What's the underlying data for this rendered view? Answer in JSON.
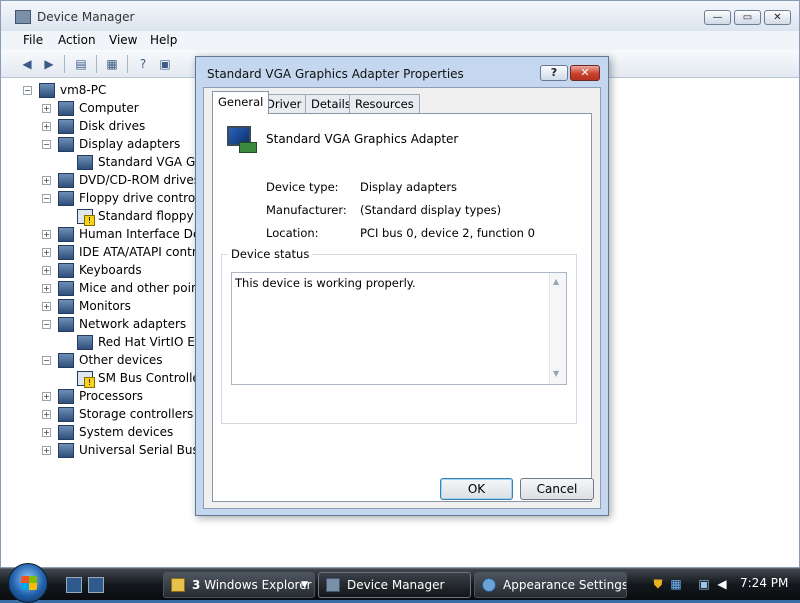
{
  "window": {
    "title": "Device Manager",
    "controls": {
      "minimize": "—",
      "maximize": "▭",
      "close": "✕"
    }
  },
  "menu": [
    "File",
    "Action",
    "View",
    "Help"
  ],
  "toolbar_icons": [
    "back-icon",
    "forward-icon",
    "properties-icon",
    "scan-icon",
    "help-icon",
    "view-icon"
  ],
  "tree": {
    "root": "vm8-PC",
    "items": [
      {
        "label": "Computer",
        "level": 1,
        "state": "+"
      },
      {
        "label": "Disk drives",
        "level": 1,
        "state": "+"
      },
      {
        "label": "Display adapters",
        "level": 1,
        "state": "−"
      },
      {
        "label": "Standard VGA Grap",
        "level": 2,
        "state": ""
      },
      {
        "label": "DVD/CD-ROM drives",
        "level": 1,
        "state": "+"
      },
      {
        "label": "Floppy drive controller",
        "level": 1,
        "state": "−"
      },
      {
        "label": "Standard floppy dis",
        "level": 2,
        "state": "",
        "warn": true
      },
      {
        "label": "Human Interface Devic",
        "level": 1,
        "state": "+"
      },
      {
        "label": "IDE ATA/ATAPI contro",
        "level": 1,
        "state": "+"
      },
      {
        "label": "Keyboards",
        "level": 1,
        "state": "+"
      },
      {
        "label": "Mice and other pointin",
        "level": 1,
        "state": "+"
      },
      {
        "label": "Monitors",
        "level": 1,
        "state": "+"
      },
      {
        "label": "Network adapters",
        "level": 1,
        "state": "−"
      },
      {
        "label": "Red Hat VirtIO Ethe",
        "level": 2,
        "state": ""
      },
      {
        "label": "Other devices",
        "level": 1,
        "state": "−"
      },
      {
        "label": "SM Bus Controller",
        "level": 2,
        "state": "",
        "warn": true
      },
      {
        "label": "Processors",
        "level": 1,
        "state": "+"
      },
      {
        "label": "Storage controllers",
        "level": 1,
        "state": "+"
      },
      {
        "label": "System devices",
        "level": 1,
        "state": "+"
      },
      {
        "label": "Universal Serial Bus co",
        "level": 1,
        "state": "+"
      }
    ]
  },
  "dialog": {
    "title": "Standard VGA Graphics Adapter Properties",
    "help_label": "?",
    "close_label": "✕",
    "tabs": [
      "General",
      "Driver",
      "Details",
      "Resources"
    ],
    "active_tab": "General",
    "device_name": "Standard VGA Graphics Adapter",
    "properties": [
      {
        "label": "Device type:",
        "value": "Display adapters"
      },
      {
        "label": "Manufacturer:",
        "value": "(Standard display types)"
      },
      {
        "label": "Location:",
        "value": "PCI bus 0, device 2, function 0"
      }
    ],
    "status_legend": "Device status",
    "status_text": "This device is working properly.",
    "ok_label": "OK",
    "cancel_label": "Cancel"
  },
  "taskbar": {
    "tasks": [
      {
        "label": "Windows Explorer",
        "count": "3",
        "active": false
      },
      {
        "label": "Device Manager",
        "active": true
      },
      {
        "label": "Appearance Settings",
        "active": false
      }
    ],
    "clock": "7:24 PM"
  }
}
